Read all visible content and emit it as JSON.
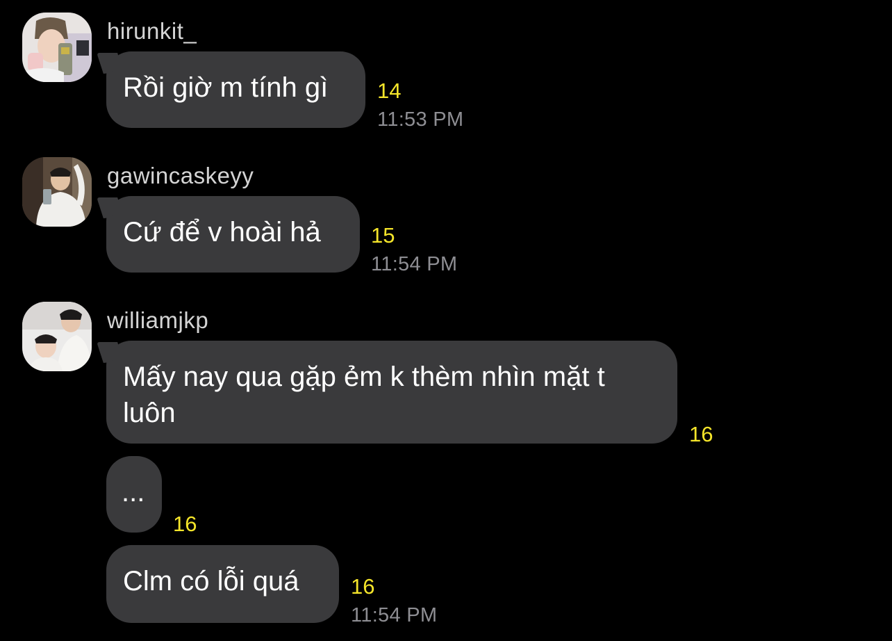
{
  "messages": [
    {
      "username": "hirunkit_",
      "avatar_icon": "profile-photo-icon",
      "text": "Rồi giờ m tính gì",
      "count": "14",
      "time": "11:53 PM"
    },
    {
      "username": "gawincaskeyy",
      "avatar_icon": "profile-photo-icon",
      "text": "Cứ để v hoài hả",
      "count": "15",
      "time": "11:54 PM"
    },
    {
      "username": "williamjkp",
      "avatar_icon": "profile-photo-icon",
      "bubbles": [
        {
          "text": "Mấy nay qua gặp ẻm k thèm nhìn mặt t luôn",
          "count": "16"
        },
        {
          "text": "...",
          "count": "16"
        },
        {
          "text": "Clm có lỗi quá",
          "count": "16",
          "time": "11:54 PM"
        }
      ]
    }
  ],
  "colors": {
    "background": "#000000",
    "bubble": "#3a3a3c",
    "count": "#f5e52a",
    "time": "#8e8e93",
    "username": "#d4d4d4"
  }
}
